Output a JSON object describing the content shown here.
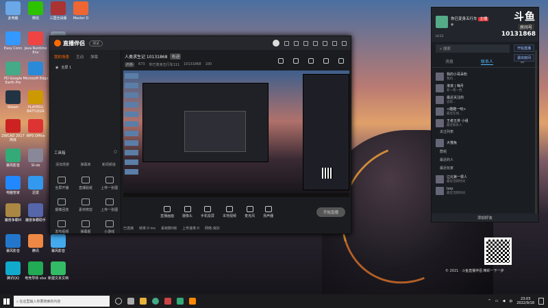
{
  "desktop": {
    "icons": [
      {
        "label": "此电脑",
        "color": "#6aa8e8"
      },
      {
        "label": "微信",
        "color": "#2dc100"
      },
      {
        "label": "三国全战版",
        "color": "#a33"
      },
      {
        "label": "Master D",
        "color": "#e63"
      },
      {
        "label": "Easy Conn",
        "color": "#39f"
      },
      {
        "label": "Java Runtime Env",
        "color": "#e44"
      },
      {
        "label": "回收站",
        "color": "#9ab"
      },
      {
        "label": "PD Google Earth Pro",
        "color": "#4a8"
      },
      {
        "label": "Microsoft Edge",
        "color": "#2a8ad8"
      },
      {
        "label": "微信截图",
        "color": "#3c6"
      },
      {
        "label": "Steam",
        "color": "#234"
      },
      {
        "label": "PLAYERU BATTLEGR",
        "color": "#c90"
      },
      {
        "label": "W3",
        "color": "#36c"
      },
      {
        "label": "ZWCAD 2017 简体",
        "color": "#c22"
      },
      {
        "label": "WPS Office",
        "color": "#d33"
      },
      {
        "label": "暴风影音",
        "color": "#3a7"
      },
      {
        "label": "SI-ob",
        "color": "#889"
      },
      {
        "label": "电脑管家",
        "color": "#28f"
      },
      {
        "label": "迅雷",
        "color": "#39e"
      },
      {
        "label": "魔兽争霸III",
        "color": "#a84"
      },
      {
        "label": "魔兽争霸助手",
        "color": "#56a"
      },
      {
        "label": "暴风影音",
        "color": "#27c"
      },
      {
        "label": "腾讯",
        "color": "#e84"
      },
      {
        "label": "暴风影音",
        "color": "#4ae"
      },
      {
        "label": "腾讯QQ",
        "color": "#1ac"
      },
      {
        "label": "电竞导师 xlsx",
        "color": "#2a5"
      },
      {
        "label": "新建文本文档",
        "color": "#3b6"
      }
    ]
  },
  "app": {
    "name": "直播伴侣",
    "version": "测试",
    "left_tabs": [
      "我的场景",
      "互动",
      "弹幕"
    ],
    "scene": "全屏 1",
    "toolbox": {
      "title": "工具箱",
      "top": [
        "添加场景",
        "弹幕库",
        "新闻频道"
      ],
      "items": [
        "全屏开播",
        "直播贴纸",
        "上传一张图",
        "摄像回放",
        "素材修剪",
        "上传一张图",
        "发布视频",
        "弹幕姬",
        "小游戏"
      ]
    },
    "room": {
      "title": "人类求生记 10131868",
      "tag": "有进",
      "category": "户外",
      "count": "673",
      "owner": "你已变身五行车111",
      "room_no": "10131868",
      "fans": "100"
    },
    "controls": [
      "直播画面",
      "摄像头",
      "手机投屏",
      "本地视频",
      "麦克风",
      "扬声器"
    ],
    "live_button": "开始直播",
    "status": [
      "已连接",
      "帧率:0 ms",
      "丢帧数0帧",
      "上传速率:0",
      "网络:良好"
    ]
  },
  "right_panel": {
    "user": "你已变身五行车",
    "badge": "主播",
    "room_label": "房间号",
    "room_no": "10131868",
    "logo": "斗鱼",
    "level": "LV.21",
    "btn1": "开始直播",
    "btn2": "退出房间",
    "search": "搜索",
    "tabs": [
      "消息",
      "联系人",
      "群"
    ],
    "items": [
      {
        "name": "我的小耳朵粉",
        "sub": "我的…"
      },
      {
        "name": "滚滚 | 嗨月",
        "sub": "新一帮一档"
      },
      {
        "name": "最近关注的",
        "sub": "追踪…"
      },
      {
        "name": "<酷酷一吧>",
        "sub": "最近在线…"
      },
      {
        "name": "王者五排 小组",
        "sub": "最近联系人"
      }
    ],
    "groups": [
      "关注列表",
      "群组",
      "最近的人"
    ],
    "friends": [
      {
        "name": "大猫兔",
        "sub": ""
      },
      {
        "name": "辽北第一狠人",
        "sub": "最近活跃时间"
      },
      {
        "name": "lzzy",
        "sub": "最近活跃时间"
      }
    ],
    "groups2": [
      "最近玩家"
    ],
    "bottom": "添加好友"
  },
  "copyright": "© 2021 · 斗鱼直播伴侣 精彩一下一步",
  "taskbar": {
    "search": "在这里输入你要搜索的内容",
    "time": "23:03",
    "date": "2022/9/18"
  }
}
